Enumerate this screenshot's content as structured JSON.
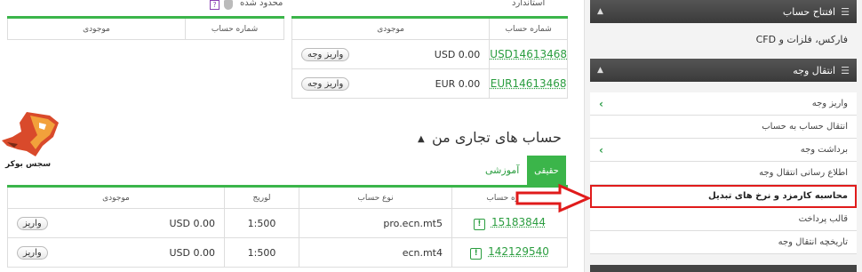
{
  "sidebar": {
    "header_open_account": "افتتاح حساب",
    "forex_link": "فارکس، فلزات و CFD",
    "header_transfer": "انتقال وجه",
    "items": [
      {
        "label": "واریز وجه",
        "chevron": true
      },
      {
        "label": "انتقال حساب به حساب",
        "chevron": false
      },
      {
        "label": "برداشت وجه",
        "chevron": true
      },
      {
        "label": "اطلاع رسانی انتقال وجه",
        "chevron": false
      },
      {
        "label": "محاسبه کارمزد و نرخ های تبدیل",
        "chevron": false,
        "highlighted": true
      },
      {
        "label": "قالب پرداخت",
        "chevron": false
      },
      {
        "label": "تاریخچه انتقال وجه",
        "chevron": false
      }
    ]
  },
  "top": {
    "standard_title": "استاندارد",
    "limited_title": "محدود شده",
    "help_icon": "?",
    "table_headers": {
      "account_number": "شماره حساب",
      "balance": "موجودی"
    },
    "std_rows": [
      {
        "account": "USD14613468",
        "balance": "USD 0.00",
        "button": "واریز وجه"
      },
      {
        "account": "EUR14613468",
        "balance": "EUR 0.00",
        "button": "واریز وجه"
      }
    ]
  },
  "trading": {
    "title": "حساب های تجاری من",
    "tab_real": "حقیقی",
    "tab_demo": "آموزشی",
    "headers": {
      "account_number": "شماره حساب",
      "account_type": "نوع حساب",
      "leverage": "لوریج",
      "balance": "موجودی"
    },
    "rows": [
      {
        "account": "15183844",
        "type": "pro.ecn.mt5",
        "leverage": "1:500",
        "balance": "USD 0.00",
        "button": "واریز"
      },
      {
        "account": "142129540",
        "type": "ecn.mt4",
        "leverage": "1:500",
        "balance": "USD 0.00",
        "button": "واریز"
      }
    ]
  },
  "logo": {
    "text": "سجس بوکر"
  },
  "colors": {
    "accent_green": "#3bb54a",
    "highlight_red": "#e01b1b",
    "sidebar_dark": "#444444"
  }
}
